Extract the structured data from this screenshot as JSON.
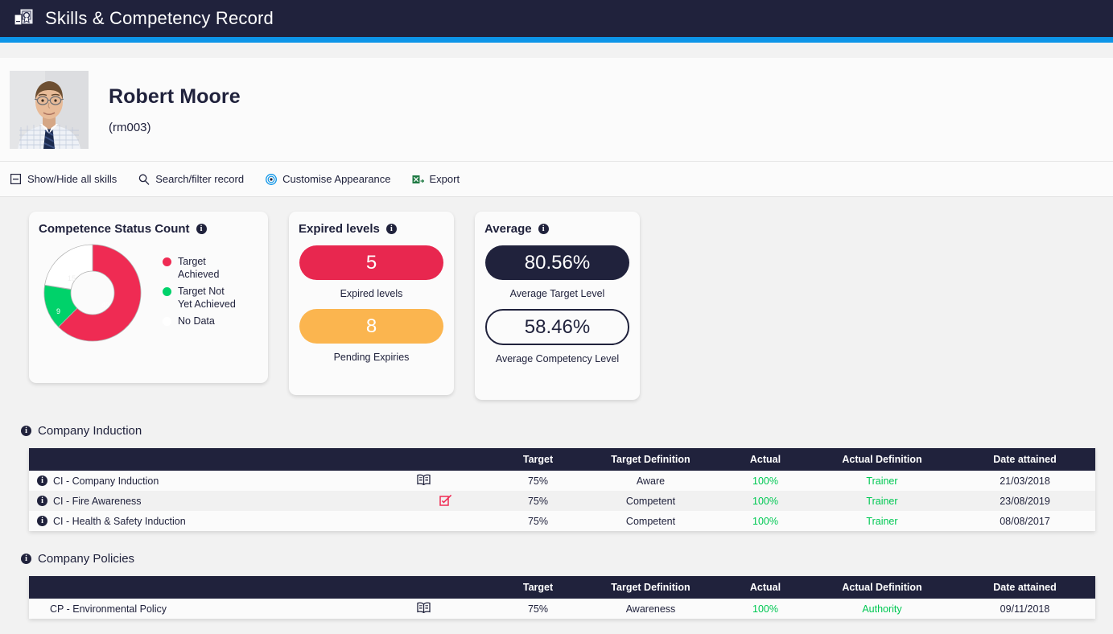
{
  "header": {
    "title": "Skills & Competency Record",
    "icon": "certificate-icon",
    "accent_color": "#0d95e8",
    "bg_color": "#20223c"
  },
  "profile": {
    "name": "Robert Moore",
    "id": "(rm003)",
    "avatar": "employee-photo"
  },
  "toolbar": {
    "items": [
      {
        "label": "Show/Hide all skills",
        "icon": "minus-square-icon"
      },
      {
        "label": "Search/filter record",
        "icon": "search-icon"
      },
      {
        "label": "Customise Appearance",
        "icon": "palette-target-icon"
      },
      {
        "label": "Export",
        "icon": "excel-export-icon"
      }
    ]
  },
  "cards": {
    "status": {
      "title": "Competence Status Count",
      "info_icon": "info-icon",
      "legend": [
        {
          "label": "Target Achieved",
          "color": "#ef2b53"
        },
        {
          "label": "Target Not Yet Achieved",
          "color": "#00d26a"
        },
        {
          "label": "No Data",
          "color": "#ffffff"
        }
      ]
    },
    "expired": {
      "title": "Expired levels",
      "info_icon": "info-icon",
      "stats": [
        {
          "value": "5",
          "caption": "Expired levels",
          "color": "#e8274f"
        },
        {
          "value": "8",
          "caption": "Pending Expiries",
          "color": "#fbb košt"
        }
      ]
    },
    "average": {
      "title": "Average",
      "info_icon": "info-icon",
      "stats": [
        {
          "value": "80.56%",
          "caption": "Average Target Level",
          "style": "filled"
        },
        {
          "value": "58.46%",
          "caption": "Average Competency Level",
          "style": "outline"
        }
      ]
    }
  },
  "chart_data": {
    "type": "pie",
    "title": "Competence Status Count",
    "categories": [
      "Target Achieved",
      "Target Not Yet Achieved",
      "No Data"
    ],
    "values": [
      40,
      9,
      15
    ],
    "colors": [
      "#ef2b53",
      "#00d26a",
      "#ffffff"
    ],
    "total": 64,
    "legend_position": "right",
    "donut": true
  },
  "table_columns": [
    "",
    "",
    "Target",
    "Target Definition",
    "Actual",
    "Actual Definition",
    "Date attained"
  ],
  "sections": [
    {
      "title": "Company Induction",
      "info_icon": "info-icon",
      "rows": [
        {
          "name": "CI - Company Induction",
          "row_icon": "book-icon",
          "icon_color": "#20223c",
          "target": "75%",
          "target_def": "Aware",
          "actual": "100%",
          "actual_def": "Trainer",
          "date": "21/03/2018"
        },
        {
          "name": "CI - Fire Awareness",
          "row_icon": "checklist-icon",
          "icon_color": "#ef2b53",
          "target": "75%",
          "target_def": "Competent",
          "actual": "100%",
          "actual_def": "Trainer",
          "date": "23/08/2019"
        },
        {
          "name": "CI - Health & Safety Induction",
          "row_icon": "",
          "icon_color": "",
          "target": "75%",
          "target_def": "Competent",
          "actual": "100%",
          "actual_def": "Trainer",
          "date": "08/08/2017"
        }
      ]
    },
    {
      "title": "Company Policies",
      "info_icon": "info-icon",
      "rows": [
        {
          "name": "CP - Environmental Policy",
          "row_icon": "book-icon",
          "icon_color": "#20223c",
          "target": "75%",
          "target_def": "Awareness",
          "actual": "100%",
          "actual_def": "Authority",
          "date": "09/11/2018"
        }
      ]
    }
  ]
}
